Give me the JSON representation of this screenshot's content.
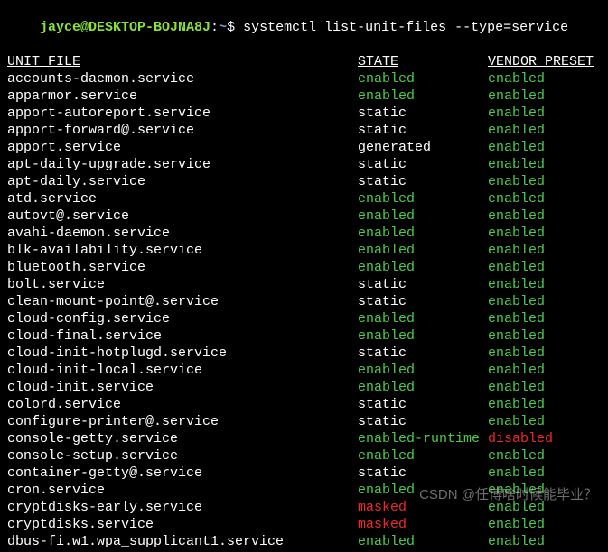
{
  "prompt": {
    "user_host": "jayce@DESKTOP-BOJNA8J",
    "colon": ":",
    "path": "~",
    "dollar": "$ ",
    "command": "systemctl list-unit-files --type=service"
  },
  "headers": {
    "unit_file": "UNIT FILE",
    "state": "STATE",
    "vendor_preset": "VENDOR PRESET"
  },
  "colors": {
    "enabled": "c-green",
    "enabled-runtime": "c-green",
    "static": "c-white",
    "generated": "c-white",
    "masked": "c-red",
    "disabled": "c-red"
  },
  "services": [
    {
      "unit": "accounts-daemon.service",
      "state": "enabled",
      "preset": "enabled"
    },
    {
      "unit": "apparmor.service",
      "state": "enabled",
      "preset": "enabled"
    },
    {
      "unit": "apport-autoreport.service",
      "state": "static",
      "preset": "enabled"
    },
    {
      "unit": "apport-forward@.service",
      "state": "static",
      "preset": "enabled"
    },
    {
      "unit": "apport.service",
      "state": "generated",
      "preset": "enabled"
    },
    {
      "unit": "apt-daily-upgrade.service",
      "state": "static",
      "preset": "enabled"
    },
    {
      "unit": "apt-daily.service",
      "state": "static",
      "preset": "enabled"
    },
    {
      "unit": "atd.service",
      "state": "enabled",
      "preset": "enabled"
    },
    {
      "unit": "autovt@.service",
      "state": "enabled",
      "preset": "enabled"
    },
    {
      "unit": "avahi-daemon.service",
      "state": "enabled",
      "preset": "enabled"
    },
    {
      "unit": "blk-availability.service",
      "state": "enabled",
      "preset": "enabled"
    },
    {
      "unit": "bluetooth.service",
      "state": "enabled",
      "preset": "enabled"
    },
    {
      "unit": "bolt.service",
      "state": "static",
      "preset": "enabled"
    },
    {
      "unit": "clean-mount-point@.service",
      "state": "static",
      "preset": "enabled"
    },
    {
      "unit": "cloud-config.service",
      "state": "enabled",
      "preset": "enabled"
    },
    {
      "unit": "cloud-final.service",
      "state": "enabled",
      "preset": "enabled"
    },
    {
      "unit": "cloud-init-hotplugd.service",
      "state": "static",
      "preset": "enabled"
    },
    {
      "unit": "cloud-init-local.service",
      "state": "enabled",
      "preset": "enabled"
    },
    {
      "unit": "cloud-init.service",
      "state": "enabled",
      "preset": "enabled"
    },
    {
      "unit": "colord.service",
      "state": "static",
      "preset": "enabled"
    },
    {
      "unit": "configure-printer@.service",
      "state": "static",
      "preset": "enabled"
    },
    {
      "unit": "console-getty.service",
      "state": "enabled-runtime",
      "preset": "disabled"
    },
    {
      "unit": "console-setup.service",
      "state": "enabled",
      "preset": "enabled"
    },
    {
      "unit": "container-getty@.service",
      "state": "static",
      "preset": "enabled"
    },
    {
      "unit": "cron.service",
      "state": "enabled",
      "preset": "enabled"
    },
    {
      "unit": "cryptdisks-early.service",
      "state": "masked",
      "preset": "enabled"
    },
    {
      "unit": "cryptdisks.service",
      "state": "masked",
      "preset": "enabled"
    },
    {
      "unit": "dbus-fi.w1.wpa_supplicant1.service",
      "state": "enabled",
      "preset": "enabled"
    }
  ],
  "watermark": "CSDN @任博啥时候能毕业？"
}
